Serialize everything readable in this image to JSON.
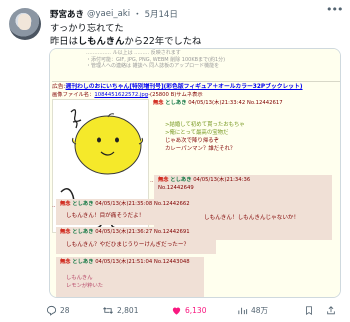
{
  "tweet": {
    "author_name": "野宮あき",
    "handle": "@yaei_aki",
    "separator": "・",
    "date": "5月14日",
    "line1": "すっかり忘れてた",
    "line2_pre": "昨日は",
    "line2_bold": "しもんきん",
    "line2_post": "から22年でしたね"
  },
  "image": {
    "faded_lines": [
      "…………… ル以上は ……… 反映されます",
      "・添付可能：GIF, JPG, PNG, WEBM 削除 100KBまで(約1分)",
      "・管理人への連絡は 雑談へ 同人誌板のアップロード機能を"
    ],
    "ad_prefix": "広告:",
    "ad_link": "週刊わしのおにいちゃん[特別増刊号](彩色版フィギュア＋オールカラー32Pブックレット)",
    "file_prefix": "画像ファイル名：",
    "file_link": "1084451622572.jpg",
    "file_suffix": "-(25800 B)サムネ表示",
    "op_subject": "無念",
    "op_name": "としあき",
    "op_meta": "04/05/13(木)21:33:42 No.12442617",
    "op_quote": [
      ">結婚して初めて貰ったおもちゃ",
      ">俺にとって最高の宝物だ"
    ],
    "op_body": [
      "じゃあ次で降り帰るぞ",
      "カレーパンマン？誰だそれ？"
    ],
    "replies": [
      {
        "subject": "無念",
        "name": "としあき",
        "meta": "04/05/13(木)21:34:36",
        "no": "No.12442649",
        "body": "しもんきん！しもんきんじゃないか！"
      },
      {
        "subject": "無念",
        "name": "としあき",
        "meta": "04/05/13(木)21:35:08 No.12442662",
        "body": "しもんきん！目が痛そうだよ！"
      },
      {
        "subject": "無念",
        "name": "としあき",
        "meta": "04/05/13(木)21:36:27 No.12442691",
        "body": "しもんきん？やだひまじうりーけんぎだったー？"
      },
      {
        "subject": "無念",
        "name": "としあき",
        "meta": "04/05/13(木)21:51:04 No.12443048",
        "body": "しもんきん",
        "body2": "レモンが粋いた"
      }
    ],
    "lemon_caption": "しもんきん"
  },
  "actions": {
    "replies": "28",
    "retweets": "2,801",
    "likes": "6,130",
    "views": "48万"
  }
}
